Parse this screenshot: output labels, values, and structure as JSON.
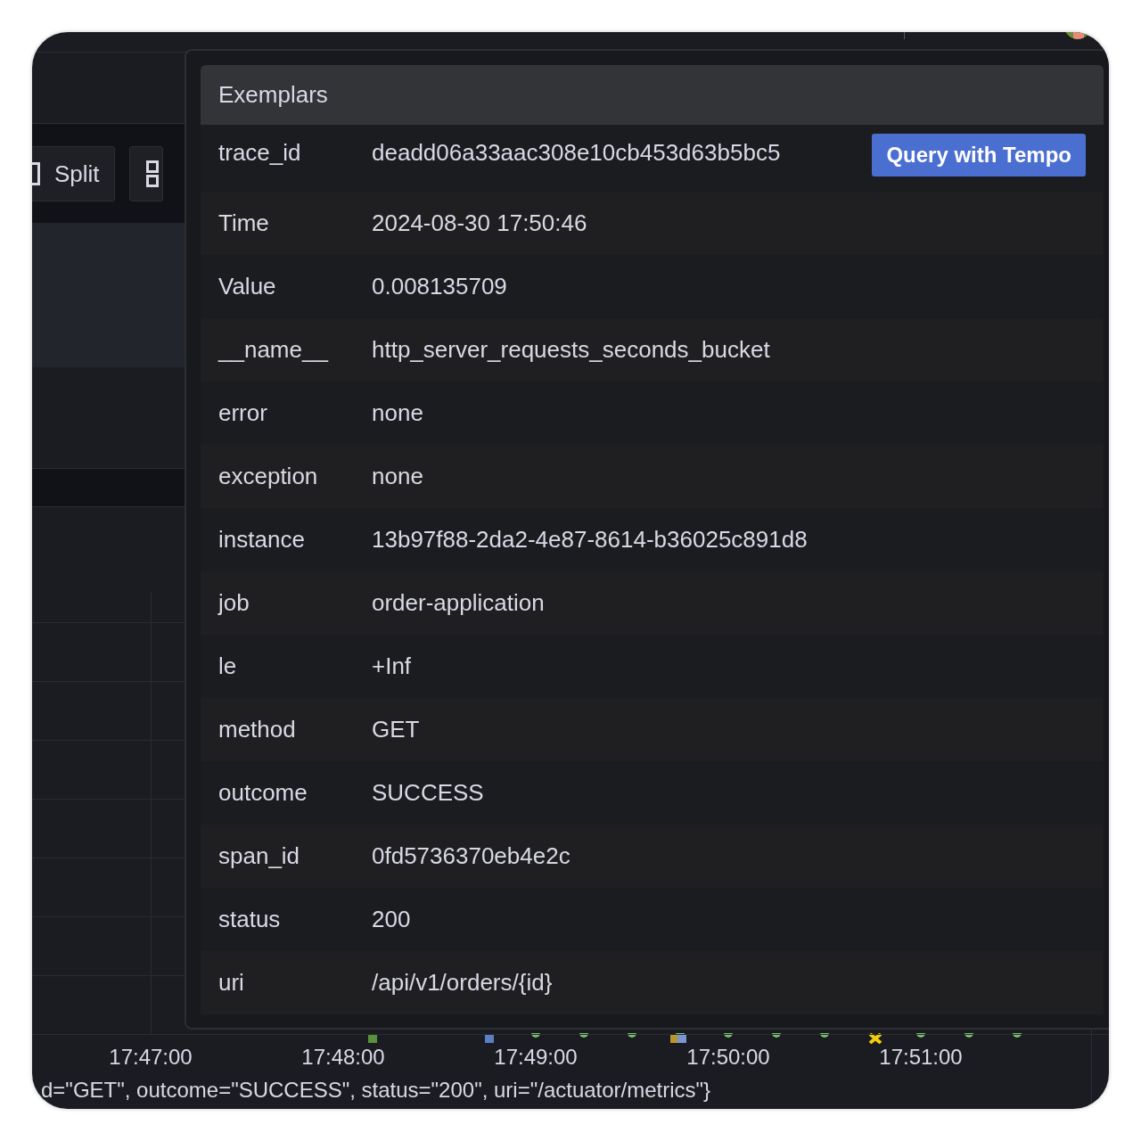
{
  "toolbar": {
    "split_button": "Split"
  },
  "exemplars": {
    "title": "Exemplars",
    "query_button": "Query with Tempo",
    "rows": [
      {
        "key": "trace_id",
        "value": "deadd06a33aac308e10cb453d63b5bc5"
      },
      {
        "key": "Time",
        "value": "2024-08-30 17:50:46"
      },
      {
        "key": "Value",
        "value": "0.008135709"
      },
      {
        "key": "__name__",
        "value": "http_server_requests_seconds_bucket"
      },
      {
        "key": "error",
        "value": "none"
      },
      {
        "key": "exception",
        "value": "none"
      },
      {
        "key": "instance",
        "value": "13b97f88-2da2-4e87-8614-b36025c891d8"
      },
      {
        "key": "job",
        "value": "order-application"
      },
      {
        "key": "le",
        "value": "+Inf"
      },
      {
        "key": "method",
        "value": "GET"
      },
      {
        "key": "outcome",
        "value": "SUCCESS"
      },
      {
        "key": "span_id",
        "value": "0fd5736370eb4e2c"
      },
      {
        "key": "status",
        "value": "200"
      },
      {
        "key": "uri",
        "value": "/api/v1/orders/{id}"
      }
    ]
  },
  "chart": {
    "x_axis_labels": [
      "17:47:00",
      "17:48:00",
      "17:49:00",
      "17:50:00",
      "17:51:00"
    ]
  },
  "legend": "d=\"GET\", outcome=\"SUCCESS\", status=\"200\", uri=\"/actuator/metrics\"}"
}
